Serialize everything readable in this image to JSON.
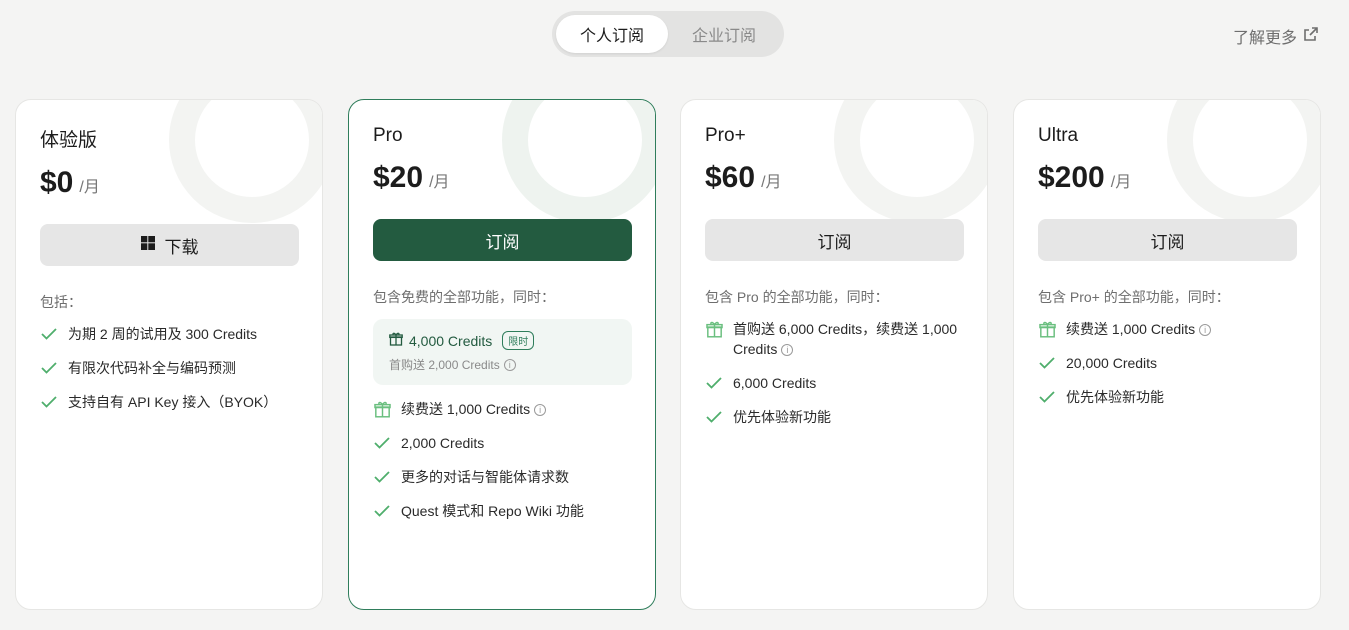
{
  "tabs": [
    {
      "label": "个人订阅",
      "active": true
    },
    {
      "label": "企业订阅",
      "active": false
    }
  ],
  "learn_more": "了解更多",
  "icons": {
    "external": "external-link-icon",
    "check": "check-icon",
    "gift": "gift-icon",
    "windows": "windows-icon",
    "info": "info-icon"
  },
  "colors": {
    "accent": "#235b40",
    "check": "#4fae6c",
    "gift": "#6abf7f"
  },
  "plans": [
    {
      "name": "体验版",
      "price": "$0",
      "per": "/月",
      "button": "下载",
      "includes": "包括：",
      "features": [
        "为期 2 周的试用及 300 Credits",
        "有限次代码补全与编码预测",
        "支持自有 API Key 接入（BYOK）"
      ]
    },
    {
      "name": "Pro",
      "price": "$20",
      "per": "/月",
      "button": "订阅",
      "includes": "包含免费的全部功能，同时：",
      "promo": {
        "title": "4,000 Credits",
        "badge": "限时",
        "sub": "首购送 2,000 Credits"
      },
      "gift": "续费送 1,000 Credits",
      "features": [
        "2,000 Credits",
        "更多的对话与智能体请求数",
        "Quest 模式和 Repo Wiki 功能"
      ]
    },
    {
      "name": "Pro+",
      "price": "$60",
      "per": "/月",
      "button": "订阅",
      "includes": "包含 Pro 的全部功能，同时：",
      "gift_line1": "首购送 6,000 Credits，续费送 1,000",
      "gift_line2": "Credits",
      "features": [
        "6,000 Credits",
        "优先体验新功能"
      ]
    },
    {
      "name": "Ultra",
      "price": "$200",
      "per": "/月",
      "button": "订阅",
      "includes": "包含 Pro+ 的全部功能，同时：",
      "gift": "续费送 1,000 Credits",
      "features": [
        "20,000 Credits",
        "优先体验新功能"
      ]
    }
  ]
}
